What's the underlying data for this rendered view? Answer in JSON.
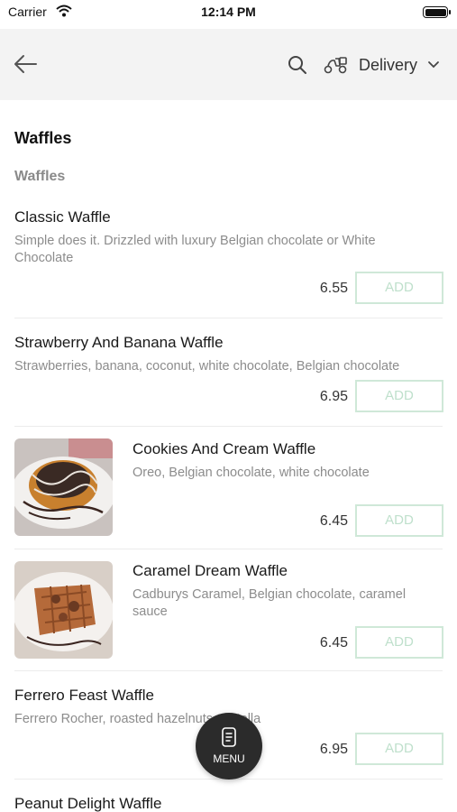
{
  "status_bar": {
    "carrier": "Carrier",
    "time": "12:14 PM"
  },
  "nav": {
    "delivery_label": "Delivery"
  },
  "section": {
    "title": "Waffles",
    "subtitle": "Waffles"
  },
  "items": [
    {
      "name": "Classic Waffle",
      "desc": "Simple does it. Drizzled with luxury Belgian chocolate or White Chocolate",
      "price": "6.55",
      "add": "ADD"
    },
    {
      "name": "Strawberry And Banana Waffle",
      "desc": "Strawberries, banana, coconut, white chocolate, Belgian chocolate",
      "price": "6.95",
      "add": "ADD"
    },
    {
      "name": "Cookies And Cream Waffle",
      "desc": "Oreo, Belgian chocolate, white chocolate",
      "price": "6.45",
      "add": "ADD"
    },
    {
      "name": "Caramel Dream Waffle",
      "desc": "Cadburys Caramel, Belgian chocolate, caramel sauce",
      "price": "6.45",
      "add": "ADD"
    },
    {
      "name": "Ferrero Feast Waffle",
      "desc": "Ferrero Rocher, roasted hazelnuts, Nutella",
      "price": "6.95",
      "add": "ADD"
    },
    {
      "name": "Peanut Delight Waffle"
    }
  ],
  "fab": {
    "label": "MENU",
    "icon": "menu-card-icon"
  },
  "colors": {
    "accent": "#bfe0cc",
    "nav_bg": "#f3f3f3",
    "fab_bg": "#2b2b2b"
  }
}
